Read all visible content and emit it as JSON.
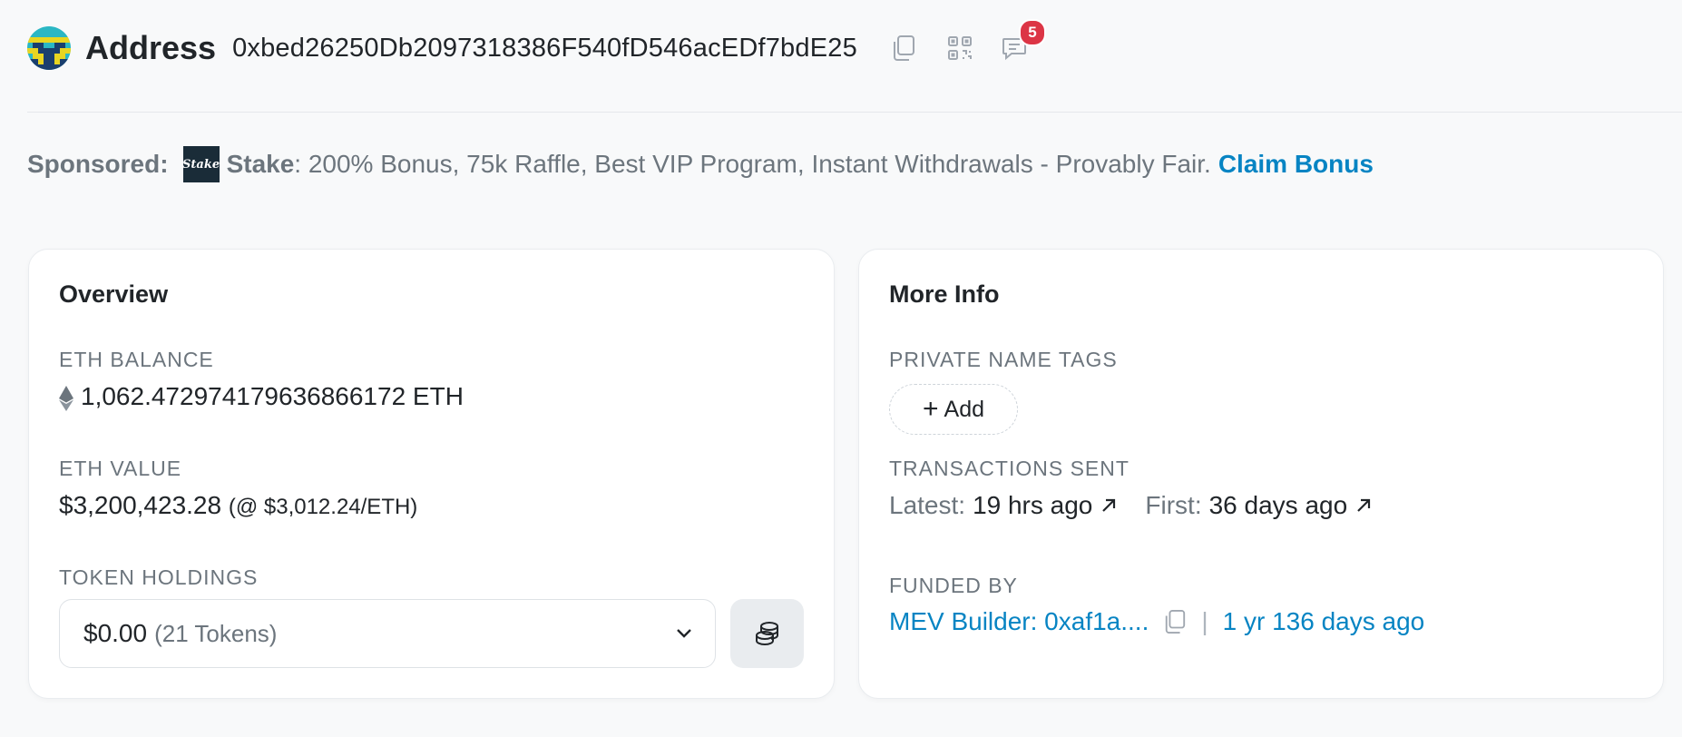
{
  "header": {
    "title": "Address",
    "address": "0xbed26250Db2097318386F540fD546acEDf7bdE25",
    "notification_count": "5"
  },
  "sponsor": {
    "label": "Sponsored:",
    "logo_text": "Stake",
    "name": "Stake",
    "text": ": 200% Bonus, 75k Raffle, Best VIP Program, Instant Withdrawals - Provably Fair.",
    "cta": "Claim Bonus"
  },
  "overview": {
    "title": "Overview",
    "eth_balance_label": "ETH BALANCE",
    "eth_balance": "1,062.472974179636866172 ETH",
    "eth_value_label": "ETH VALUE",
    "eth_value": "$3,200,423.28",
    "eth_price": "(@ $3,012.24/ETH)",
    "token_holdings_label": "TOKEN HOLDINGS",
    "token_value": "$0.00",
    "token_count": "(21 Tokens)"
  },
  "more_info": {
    "title": "More Info",
    "private_tags_label": "PRIVATE NAME TAGS",
    "add_label": "Add",
    "tx_sent_label": "TRANSACTIONS SENT",
    "latest_label": "Latest:",
    "latest_value": "19 hrs ago",
    "first_label": "First:",
    "first_value": "36 days ago",
    "funded_by_label": "FUNDED BY",
    "funded_by_value": "MEV Builder: 0xaf1a....",
    "funded_separator": "|",
    "funded_age": "1 yr 136 days ago"
  },
  "colors": {
    "link": "#0784c3",
    "muted": "#6c757d",
    "badge": "#dc3545"
  }
}
